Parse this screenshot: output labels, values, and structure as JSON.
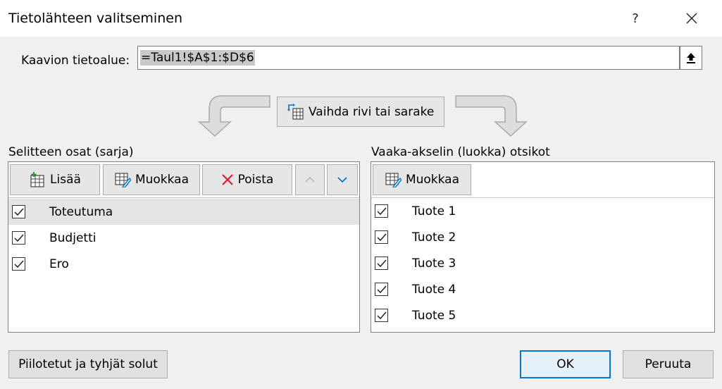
{
  "window": {
    "title": "Tietolähteen valitseminen",
    "help_label": "?",
    "close_label": "✕"
  },
  "data_range": {
    "label": "Kaavion tietoalue:",
    "value": "=Taul1!$A$1:$D$6"
  },
  "switch_button": {
    "label": "Vaihda rivi tai sarake"
  },
  "legend_panel": {
    "label": "Selitteen osat (sarja)",
    "add_label": "Lisää",
    "edit_label": "Muokkaa",
    "remove_label": "Poista",
    "items": [
      {
        "label": "Toteutuma",
        "checked": true,
        "selected": true
      },
      {
        "label": "Budjetti",
        "checked": true,
        "selected": false
      },
      {
        "label": "Ero",
        "checked": true,
        "selected": false
      }
    ]
  },
  "axis_panel": {
    "label": "Vaaka-akselin (luokka) otsikot",
    "edit_label": "Muokkaa",
    "items": [
      {
        "label": "Tuote 1",
        "checked": true
      },
      {
        "label": "Tuote 2",
        "checked": true
      },
      {
        "label": "Tuote 3",
        "checked": true
      },
      {
        "label": "Tuote 4",
        "checked": true
      },
      {
        "label": "Tuote 5",
        "checked": true
      }
    ]
  },
  "footer": {
    "hidden_cells_label": "Piilotetut ja tyhjät solut",
    "ok_label": "OK",
    "cancel_label": "Peruuta"
  },
  "colors": {
    "accent": "#0078d7",
    "remove_red": "#e81123",
    "arrow_blue": "#0078d7"
  }
}
